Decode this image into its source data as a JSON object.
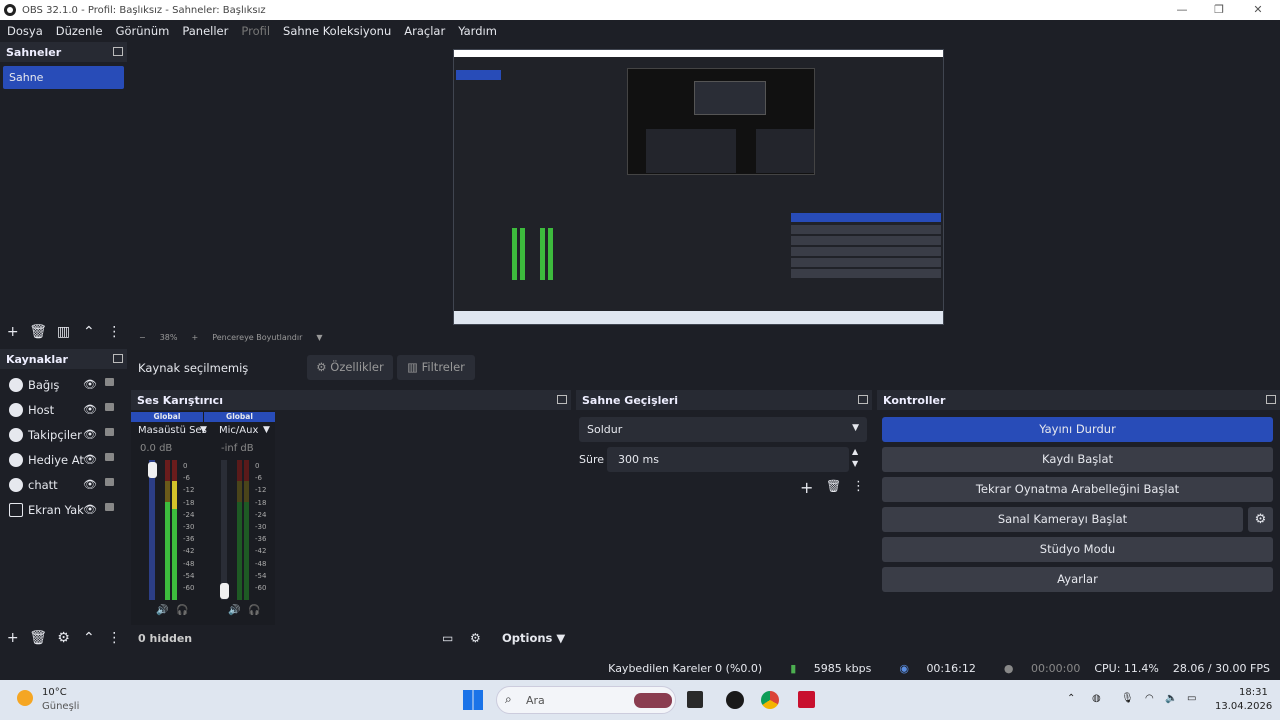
{
  "window": {
    "title": "OBS 32.1.0 - Profil: Başlıksız - Sahneler: Başlıksız",
    "minimize": "—",
    "maximize": "❐",
    "close": "✕"
  },
  "menu": [
    "Dosya",
    "Düzenle",
    "Görünüm",
    "Paneller",
    "Profil",
    "Sahne Koleksiyonu",
    "Araçlar",
    "Yardım"
  ],
  "scenes": {
    "title": "Sahneler",
    "items": [
      "Sahne"
    ]
  },
  "sources": {
    "title": "Kaynaklar",
    "items": [
      {
        "name": "Bağış",
        "icon": "globe-icon"
      },
      {
        "name": "Host",
        "icon": "globe-icon"
      },
      {
        "name": "Takipçiler",
        "icon": "globe-icon"
      },
      {
        "name": "Hediye At",
        "icon": "globe-icon"
      },
      {
        "name": "chatt",
        "icon": "globe-icon"
      },
      {
        "name": "Ekran Yak",
        "icon": "monitor-icon"
      }
    ]
  },
  "preview_toolbar": {
    "zoom_minus": "−",
    "zoom": "38%",
    "zoom_plus": "+",
    "fit": "Pencereye Boyutlandır"
  },
  "source_bar": {
    "no_source": "Kaynak seçilmemiş",
    "properties": "Özellikler",
    "filters": "Filtreler"
  },
  "mixer": {
    "title": "Ses Karıştırıcı",
    "channels": [
      {
        "tag": "Global",
        "name": "Masaüstü Ses",
        "db": "0.0 dB"
      },
      {
        "tag": "Global",
        "name": "Mic/Aux",
        "db": "-inf dB"
      }
    ],
    "scale": [
      "0",
      "-6",
      "-12",
      "-18",
      "-24",
      "-30",
      "-36",
      "-42",
      "-48",
      "-54",
      "-60"
    ],
    "hidden": "0 hidden",
    "options": "Options"
  },
  "transitions": {
    "title": "Sahne Geçişleri",
    "selected": "Soldur",
    "duration_label": "Süre",
    "duration": "300 ms"
  },
  "controls": {
    "title": "Kontroller",
    "buttons": [
      "Yayını Durdur",
      "Kaydı Başlat",
      "Tekrar Oynatma Arabelleğini Başlat",
      "Sanal Kamerayı Başlat",
      "Stüdyo Modu",
      "Ayarlar"
    ]
  },
  "status": {
    "dropped": "Kaybedilen Kareler 0 (%0.0)",
    "bitrate": "5985 kbps",
    "live_time": "00:16:12",
    "rec_time": "00:00:00",
    "cpu": "CPU: 11.4%",
    "fps": "28.06 / 30.00 FPS"
  },
  "taskbar": {
    "temp": "10°C",
    "weather": "Güneşli",
    "search": "Ara",
    "time": "18:31",
    "date": "13.04.2026"
  },
  "colors": {
    "accent": "#284cb8",
    "bg": "#1d1f26",
    "live": "#4caf50"
  }
}
